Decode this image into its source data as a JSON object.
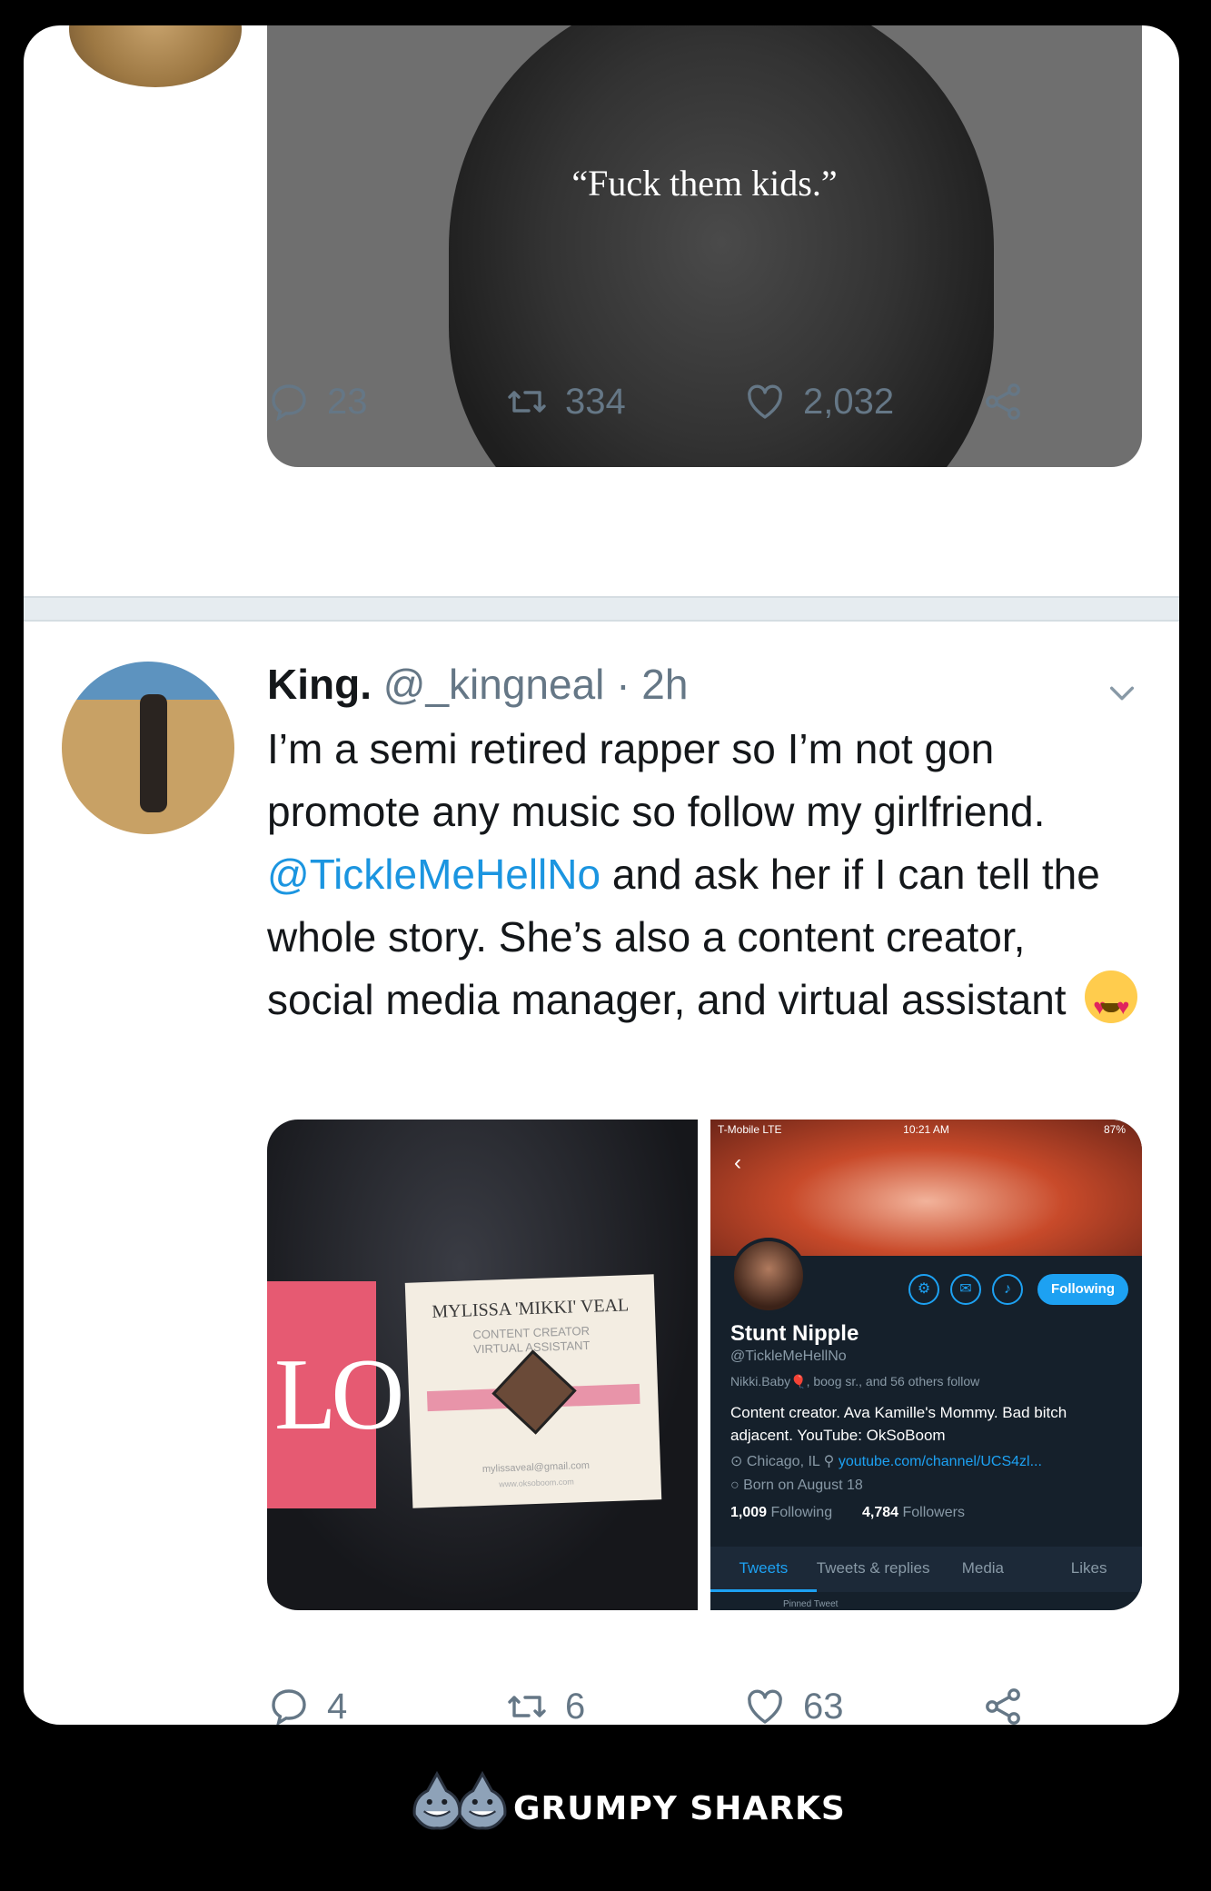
{
  "tweet1": {
    "image_caption": "“Fuck them kids.”",
    "replies": "23",
    "retweets": "334",
    "likes": "2,032"
  },
  "tweet2": {
    "display_name": "King.",
    "handle": "@_kingneal",
    "time": "· 2h",
    "text_before_mention": "I’m a semi retired rapper so I’m not gon promote any music so follow my girlfriend. ",
    "mention": "@TickleMeHellNo",
    "text_after_mention": " and ask her if I can tell the whole story. She’s also a content creator, social media manager, and virtual assistant",
    "emoji": "heart-eyes-emoji",
    "replies": "4",
    "retweets": "6",
    "likes": "63"
  },
  "business_card": {
    "pink_card_text": "LO",
    "name": "MYLISSA 'MIKKI' VEAL",
    "line1": "CONTENT CREATOR",
    "line2": "VIRTUAL ASSISTANT",
    "email": "mylissaveal@gmail.com",
    "website": "www.oksoboom.com"
  },
  "profile_screenshot": {
    "carrier": "T-Mobile  LTE",
    "time": "10:21 AM",
    "battery": "87%",
    "follow_button": "Following",
    "name": "Stunt Nipple",
    "handle": "@TickleMeHellNo",
    "followed_by": "Nikki.Baby🎈, boog sr., and 56 others follow",
    "bio": "Content creator. Ava Kamille's Mommy. Bad bitch adjacent. YouTube: OkSoBoom",
    "location": "Chicago, IL",
    "link": "youtube.com/channel/UCS4zl...",
    "born": "Born on August 18",
    "following_count": "1,009",
    "following_label": "Following",
    "followers_count": "4,784",
    "followers_label": "Followers",
    "tabs": [
      "Tweets",
      "Tweets & replies",
      "Media",
      "Likes"
    ],
    "pinned": "Pinned Tweet"
  },
  "footer": {
    "brand": "GRUMPY SHARKS"
  },
  "colors": {
    "link_blue": "#1b95e0",
    "muted_gray": "#657786",
    "dark_profile_bg": "#15202b",
    "twitter_blue": "#1da1f2"
  }
}
